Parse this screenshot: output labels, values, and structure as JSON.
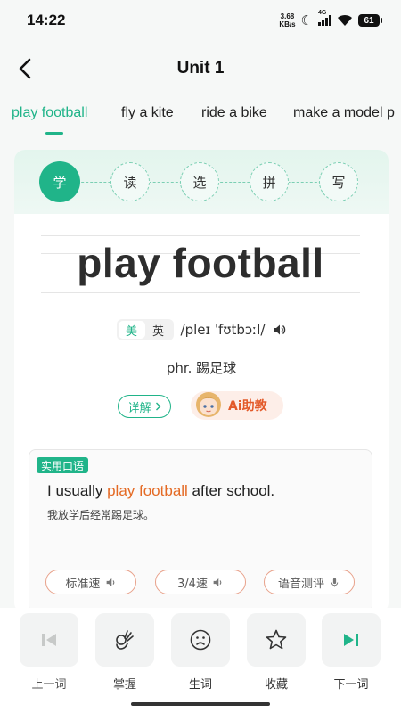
{
  "status_bar": {
    "time": "14:22",
    "net_speed_value": "3.68",
    "net_speed_unit": "KB/s",
    "network_type": "4G",
    "battery": "61"
  },
  "nav": {
    "title": "Unit 1"
  },
  "phrase_tabs": [
    {
      "label": "play football",
      "active": true
    },
    {
      "label": "fly a kite",
      "active": false
    },
    {
      "label": "ride a bike",
      "active": false
    },
    {
      "label": "make a model p",
      "active": false
    }
  ],
  "steps": [
    {
      "label": "学",
      "active": true
    },
    {
      "label": "读",
      "active": false
    },
    {
      "label": "选",
      "active": false
    },
    {
      "label": "拼",
      "active": false
    },
    {
      "label": "写",
      "active": false
    }
  ],
  "word": {
    "text": "play football",
    "accent_us": "美",
    "accent_uk": "英",
    "selected_accent": "美",
    "phonetic": "/pleɪ ˈfʊtbɔːl/",
    "definition": "phr. 踢足球"
  },
  "detail_button": "详解",
  "ai_button": "Ai助教",
  "example": {
    "tag": "实用口语",
    "sentence_before": "I usually ",
    "sentence_highlight": "play football",
    "sentence_after": " after school.",
    "translation": "我放学后经常踢足球。"
  },
  "speed_buttons": {
    "standard": "标准速",
    "three_quarter": "3/4速",
    "evaluate": "语音测评"
  },
  "bottom_actions": {
    "prev": "上一词",
    "master": "掌握",
    "new_word": "生词",
    "favorite": "收藏",
    "next": "下一词"
  },
  "colors": {
    "accent": "#20b489",
    "highlight": "#e46a24",
    "ai_text": "#e35a2a"
  }
}
